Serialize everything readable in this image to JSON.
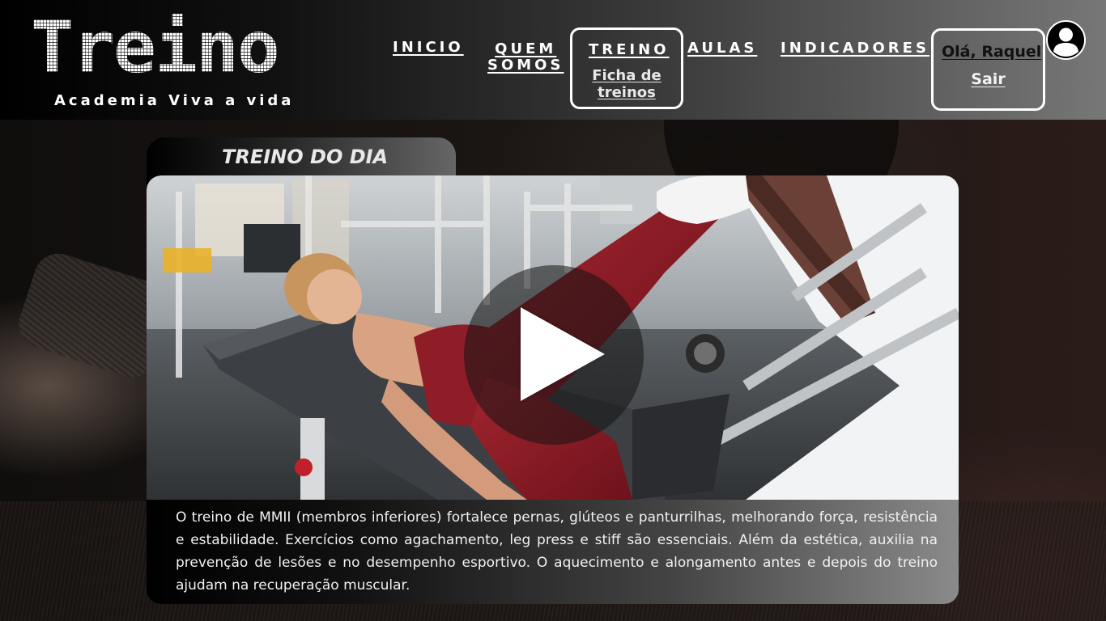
{
  "header": {
    "logo_text": "Treino",
    "tagline": "Academia Viva a vida",
    "nav": {
      "inicio": "INICIO",
      "quem_somos_line1": "QUEM",
      "quem_somos_line2": "SOMOS",
      "treino": "TREINO",
      "ficha_de_treinos": "Ficha de treinos",
      "aulas": "AULAS",
      "indicadores": "INDICADORES"
    },
    "user": {
      "greeting": "Olá, Raquel",
      "logout": "Sair",
      "avatar_icon": "user-avatar-icon"
    }
  },
  "main": {
    "section_title": "TREINO DO DIA",
    "video": {
      "play_icon": "play-icon"
    },
    "description": "O treino de MMII (membros inferiores) fortalece pernas, glúteos e panturrilhas, melhorando força, resistência e estabilidade. Exercícios como agachamento, leg press e stiff são essenciais. Além da estética, auxilia na prevenção de lesões e no desempenho esportivo. O aquecimento e alongamento antes e depois do treino ajudam na recuperação muscular."
  },
  "colors": {
    "accent": "#ffffff",
    "outfit": "#8a1a24",
    "machine": "#e9ecef"
  }
}
